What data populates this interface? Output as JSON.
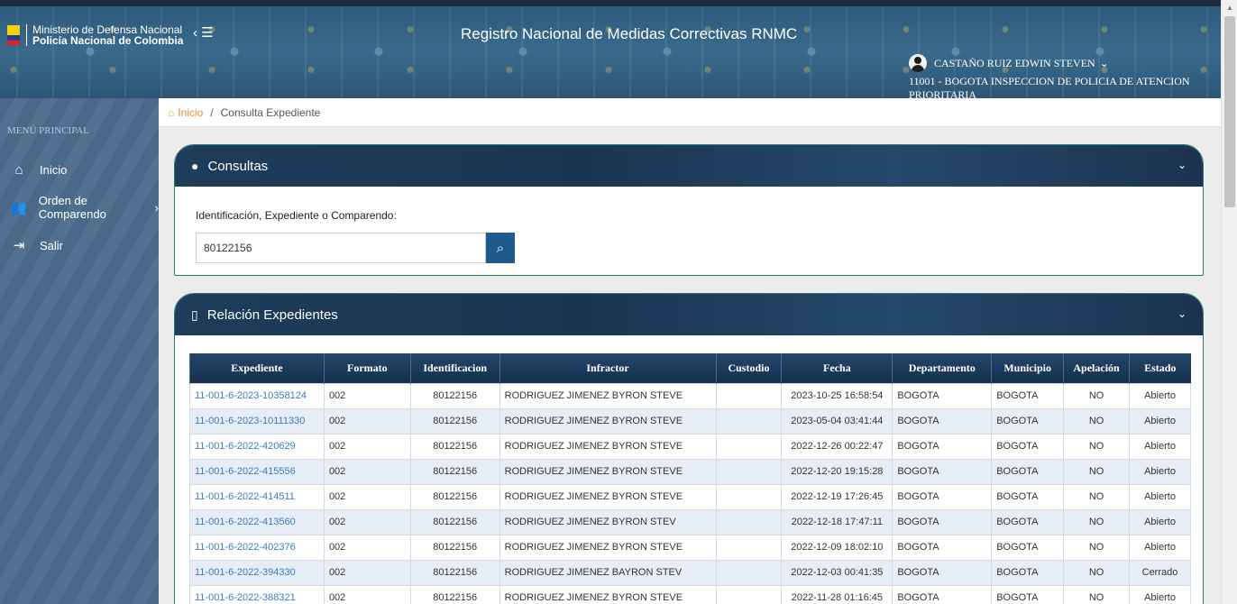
{
  "header": {
    "org_line1": "Ministerio de Defensa Nacional",
    "org_line2": "Policía Nacional de Colombia",
    "menu_toggle_icon": "chevron-left-bars-icon",
    "title": "Registro Nacional de Medidas Correctivas RNMC",
    "user_name": "CASTAÑO RUIZ EDWIN STEVEN",
    "user_location": "11001 - BOGOTA  INSPECCION DE POLICIA DE ATENCION PRIORITARIA"
  },
  "sidebar": {
    "heading": "MENÚ PRINCIPAL",
    "items": [
      {
        "label": "Inicio",
        "icon": "home-icon"
      },
      {
        "label": "Orden de Comparendo",
        "icon": "people-icon",
        "has_submenu": true
      },
      {
        "label": "Salir",
        "icon": "logout-icon"
      }
    ]
  },
  "breadcrumb": {
    "home": "Inicio",
    "current": "Consulta Expediente"
  },
  "consultas": {
    "title": "Consultas",
    "field_label": "Identificación, Expediente o Comparendo:",
    "field_value": "80122156"
  },
  "relacion": {
    "title": "Relación Expedientes",
    "columns": [
      "Expediente",
      "Formato",
      "Identificacion",
      "Infractor",
      "Custodio",
      "Fecha",
      "Departamento",
      "Municipio",
      "Apelación",
      "Estado"
    ],
    "rows": [
      [
        "11-001-6-2023-10358124",
        "002",
        "80122156",
        "RODRIGUEZ JIMENEZ BYRON STEVE",
        "",
        "2023-10-25 16:58:54",
        "BOGOTA",
        "BOGOTA",
        "NO",
        "Abierto"
      ],
      [
        "11-001-6-2023-10111330",
        "002",
        "80122156",
        "RODRIGUEZ JIMENEZ BYRON STEVE",
        "",
        "2023-05-04 03:41:44",
        "BOGOTA",
        "BOGOTA",
        "NO",
        "Abierto"
      ],
      [
        "11-001-6-2022-420629",
        "002",
        "80122156",
        "RODRIGUEZ JIMENEZ BYRON STEVE",
        "",
        "2022-12-26 00:22:47",
        "BOGOTA",
        "BOGOTA",
        "NO",
        "Abierto"
      ],
      [
        "11-001-6-2022-415556",
        "002",
        "80122156",
        "RODRIGUEZ JIMENEZ BYRON STEVE",
        "",
        "2022-12-20 19:15:28",
        "BOGOTA",
        "BOGOTA",
        "NO",
        "Abierto"
      ],
      [
        "11-001-6-2022-414511",
        "002",
        "80122156",
        "RODRIGUEZ JIMENEZ BYRON STEVE",
        "",
        "2022-12-19 17:26:45",
        "BOGOTA",
        "BOGOTA",
        "NO",
        "Abierto"
      ],
      [
        "11-001-6-2022-413560",
        "002",
        "80122156",
        "RODRIGUEZ JIMENEZ BYRON STEV",
        "",
        "2022-12-18 17:47:11",
        "BOGOTA",
        "BOGOTA",
        "NO",
        "Abierto"
      ],
      [
        "11-001-6-2022-402376",
        "002",
        "80122156",
        "RODRIGUEZ JIMENEZ BYRON STEVE",
        "",
        "2022-12-09 18:02:10",
        "BOGOTA",
        "BOGOTA",
        "NO",
        "Abierto"
      ],
      [
        "11-001-6-2022-394330",
        "002",
        "80122156",
        "RODRIGUEZ JIMENEZ BAYRON STEV",
        "",
        "2022-12-03 00:41:35",
        "BOGOTA",
        "BOGOTA",
        "NO",
        "Cerrado"
      ],
      [
        "11-001-6-2022-388321",
        "002",
        "80122156",
        "RODRIGUEZ JIMENEZ BYRON STEVE",
        "",
        "2022-11-28 01:16:45",
        "BOGOTA",
        "BOGOTA",
        "NO",
        "Abierto"
      ]
    ]
  }
}
